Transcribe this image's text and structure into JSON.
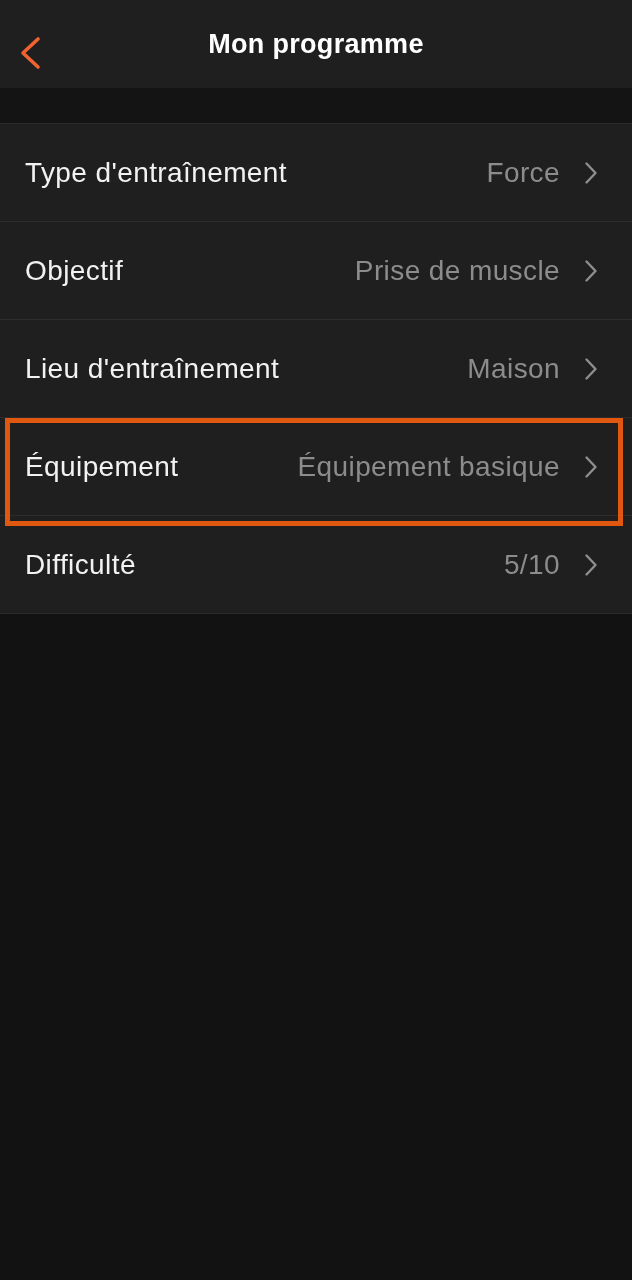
{
  "header": {
    "title": "Mon programme"
  },
  "settings": [
    {
      "label": "Type d'entraînement",
      "value": "Force",
      "highlighted": false
    },
    {
      "label": "Objectif",
      "value": "Prise de muscle",
      "highlighted": false
    },
    {
      "label": "Lieu d'entraînement",
      "value": "Maison",
      "highlighted": false
    },
    {
      "label": "Équipement",
      "value": "Équipement basique",
      "highlighted": true
    },
    {
      "label": "Difficulté",
      "value": "5/10",
      "highlighted": false
    }
  ]
}
